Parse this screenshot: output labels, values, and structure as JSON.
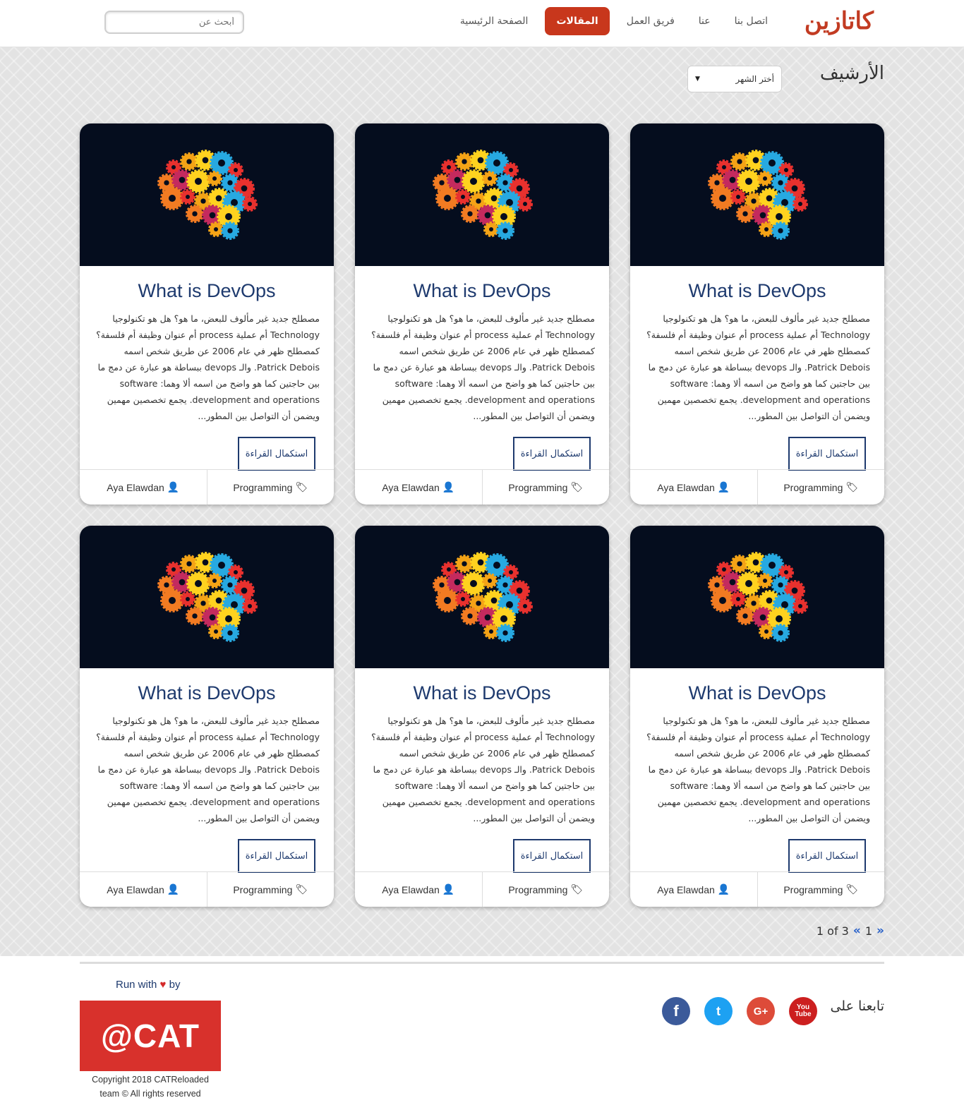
{
  "header": {
    "logo": "كاتازين",
    "nav": [
      {
        "label": "الصفحة الرئيسية",
        "active": false
      },
      {
        "label": "المقالات",
        "active": true
      },
      {
        "label": "فريق العمل",
        "active": false
      },
      {
        "label": "عنا",
        "active": false
      },
      {
        "label": "اتصل بنا",
        "active": false
      }
    ],
    "search_placeholder": "أبحث عن"
  },
  "archive": {
    "title": "الأرشيف",
    "month_select": "أختر الشهر"
  },
  "cards": [
    {
      "title": "What is DevOps",
      "excerpt": "مصطلح جديد غير مألوف للبعض، ما هو؟ هل هو تكنولوجيا Technology أم عملية process أم عنوان وظيفة أم فلسفة؟ كمصطلح ظهر في عام 2006 عن طريق شخص اسمه Patrick Debois. والـ devops ببساطة هو عبارة عن دمج ما بين حاجتين كما هو واضح من اسمه ألا وهما: software development and operations. يجمع تخصصين مهمين ويضمن أن التواصل بين المطور...",
      "read_more": "استكمال القراءة",
      "author": "Aya Elawdan",
      "category": "Programming"
    },
    {
      "title": "What is DevOps",
      "excerpt": "مصطلح جديد غير مألوف للبعض، ما هو؟ هل هو تكنولوجيا Technology أم عملية process أم عنوان وظيفة أم فلسفة؟ كمصطلح ظهر في عام 2006 عن طريق شخص اسمه Patrick Debois. والـ devops ببساطة هو عبارة عن دمج ما بين حاجتين كما هو واضح من اسمه ألا وهما: software development and operations. يجمع تخصصين مهمين ويضمن أن التواصل بين المطور...",
      "read_more": "استكمال القراءة",
      "author": "Aya Elawdan",
      "category": "Programming"
    },
    {
      "title": "What is DevOps",
      "excerpt": "مصطلح جديد غير مألوف للبعض، ما هو؟ هل هو تكنولوجيا Technology أم عملية process أم عنوان وظيفة أم فلسفة؟ كمصطلح ظهر في عام 2006 عن طريق شخص اسمه Patrick Debois. والـ devops ببساطة هو عبارة عن دمج ما بين حاجتين كما هو واضح من اسمه ألا وهما: software development and operations. يجمع تخصصين مهمين ويضمن أن التواصل بين المطور...",
      "read_more": "استكمال القراءة",
      "author": "Aya Elawdan",
      "category": "Programming"
    },
    {
      "title": "What is DevOps",
      "excerpt": "مصطلح جديد غير مألوف للبعض، ما هو؟ هل هو تكنولوجيا Technology أم عملية process أم عنوان وظيفة أم فلسفة؟ كمصطلح ظهر في عام 2006 عن طريق شخص اسمه Patrick Debois. والـ devops ببساطة هو عبارة عن دمج ما بين حاجتين كما هو واضح من اسمه ألا وهما: software development and operations. يجمع تخصصين مهمين ويضمن أن التواصل بين المطور...",
      "read_more": "استكمال القراءة",
      "author": "Aya Elawdan",
      "category": "Programming"
    },
    {
      "title": "What is DevOps",
      "excerpt": "مصطلح جديد غير مألوف للبعض، ما هو؟ هل هو تكنولوجيا Technology أم عملية process أم عنوان وظيفة أم فلسفة؟ كمصطلح ظهر في عام 2006 عن طريق شخص اسمه Patrick Debois. والـ devops ببساطة هو عبارة عن دمج ما بين حاجتين كما هو واضح من اسمه ألا وهما: software development and operations. يجمع تخصصين مهمين ويضمن أن التواصل بين المطور...",
      "read_more": "استكمال القراءة",
      "author": "Aya Elawdan",
      "category": "Programming"
    },
    {
      "title": "What is DevOps",
      "excerpt": "مصطلح جديد غير مألوف للبعض، ما هو؟ هل هو تكنولوجيا Technology أم عملية process أم عنوان وظيفة أم فلسفة؟ كمصطلح ظهر في عام 2006 عن طريق شخص اسمه Patrick Debois. والـ devops ببساطة هو عبارة عن دمج ما بين حاجتين كما هو واضح من اسمه ألا وهما: software development and operations. يجمع تخصصين مهمين ويضمن أن التواصل بين المطور...",
      "read_more": "استكمال القراءة",
      "author": "Aya Elawdan",
      "category": "Programming"
    }
  ],
  "pagination": {
    "current_page": "1",
    "page_of": "1 of 3"
  },
  "footer": {
    "run_with_prefix": "Run with",
    "heart": "♥",
    "run_with_suffix": "by",
    "cat_logo_text": "@CAT",
    "copyright_line1": "Copyright 2018 CATReloaded",
    "copyright_line2": "team © All rights reserved",
    "follow_us": "تابعنا على",
    "socials": [
      {
        "name": "facebook",
        "glyph": "f",
        "color": "#3b5a9a"
      },
      {
        "name": "twitter",
        "glyph": "t",
        "color": "#1da1f2"
      },
      {
        "name": "google-plus",
        "glyph": "G+",
        "color": "#dd4b39"
      },
      {
        "name": "youtube",
        "glyph": "You Tube",
        "color": "#cc1f1f"
      }
    ]
  }
}
